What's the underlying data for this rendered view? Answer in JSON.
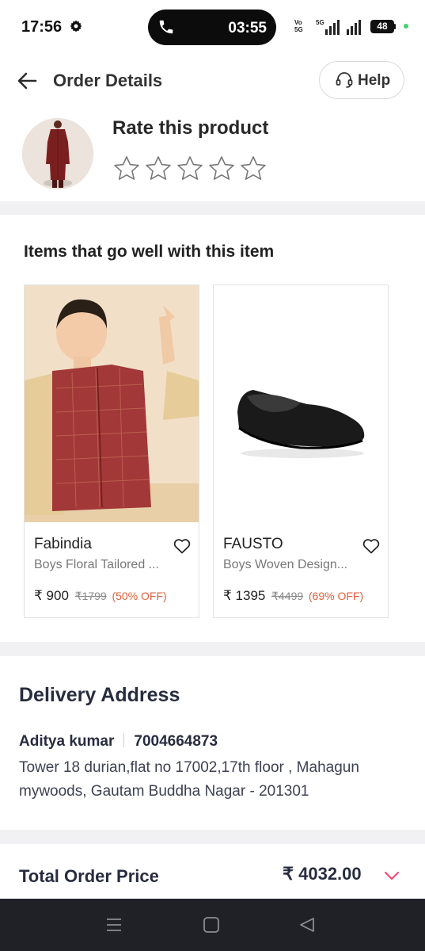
{
  "status_bar": {
    "time": "17:56",
    "call_timer": "03:55",
    "volte_label": "Vo\n5G",
    "network_label": "5G",
    "battery_level": "48"
  },
  "header": {
    "title": "Order Details",
    "help_label": "Help"
  },
  "rating": {
    "title": "Rate this product",
    "star_count": 5,
    "current_rating": 0
  },
  "recommendations": {
    "title": "Items that go well with this item",
    "items": [
      {
        "brand": "Fabindia",
        "description": "Boys Floral Tailored ...",
        "price": "₹ 900",
        "mrp": "₹1799",
        "discount": "(50% OFF)"
      },
      {
        "brand": "FAUSTO",
        "description": "Boys Woven Design...",
        "price": "₹ 1395",
        "mrp": "₹4499",
        "discount": "(69% OFF)"
      }
    ]
  },
  "delivery": {
    "heading": "Delivery Address",
    "name": "Aditya kumar",
    "phone": "7004664873",
    "address_line1": "Tower 18 durian,flat no 17002,17th floor , Mahagun",
    "address_line2": "mywoods, Gautam Buddha Nagar - 201301"
  },
  "order_total": {
    "label": "Total Order Price",
    "value": "₹ 4032.00"
  },
  "colors": {
    "accent": "#ff3f6c",
    "discount": "#e2623a",
    "divider": "#f1f1f3",
    "nav_bar": "#1f2127"
  }
}
